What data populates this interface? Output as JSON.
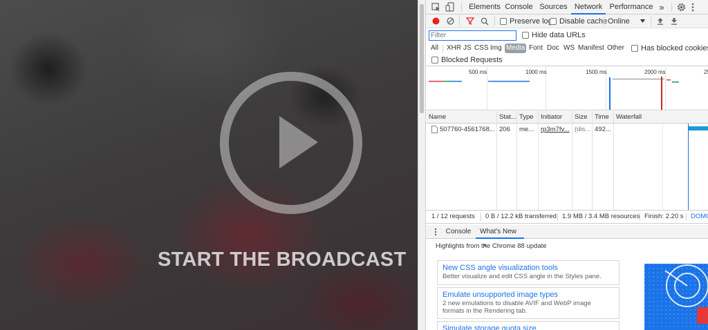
{
  "video": {
    "title": "START THE BROADCAST"
  },
  "devtools": {
    "tabs": [
      "Elements",
      "Console",
      "Sources",
      "Network",
      "Performance"
    ],
    "active_tab": "Network",
    "more_tabs": "»",
    "toolbar": {
      "preserve_log": "Preserve log",
      "disable_cache": "Disable cache",
      "throttling": "Online"
    },
    "filter": {
      "placeholder": "Filter",
      "hide_data_urls": "Hide data URLs",
      "types": [
        "All",
        "XHR",
        "JS",
        "CSS",
        "Img",
        "Media",
        "Font",
        "Doc",
        "WS",
        "Manifest",
        "Other"
      ],
      "active_type": "Media",
      "has_blocked_cookies": "Has blocked cookies",
      "blocked_requests": "Blocked Requests"
    },
    "overview": {
      "ticks": [
        "500 ms",
        "1000 ms",
        "1500 ms",
        "2000 ms",
        "25"
      ]
    },
    "grid": {
      "columns": [
        "Name",
        "Stat...",
        "Type",
        "Initiator",
        "Size",
        "Time",
        "Waterfall"
      ],
      "rows": [
        {
          "name": "507760-4561768...",
          "status": "206",
          "type": "me...",
          "initiator": "rp3m7fv...",
          "size": "(dis...",
          "time": "492..."
        }
      ]
    },
    "status": {
      "requests": "1 / 12 requests",
      "transferred": "0 B / 12.2 kB transferred",
      "resources": "1.9 MB / 3.4 MB resources",
      "finish": "Finish: 2.20 s",
      "domcontent": "DOMC"
    },
    "drawer": {
      "tabs": [
        "Console",
        "What's New"
      ],
      "active_tab": "What's New",
      "close": "×",
      "highlights": "Highlights from the Chrome 88 update",
      "cards": [
        {
          "title": "New CSS angle visualization tools",
          "desc": "Better visualize and edit CSS angle in the Styles pane."
        },
        {
          "title": "Emulate unsupported image types",
          "desc": "2 new emulations to disable AVIF and WebP image formats in the Rendering tab."
        },
        {
          "title": "Simulate storage quota size",
          "desc": ""
        }
      ]
    }
  }
}
